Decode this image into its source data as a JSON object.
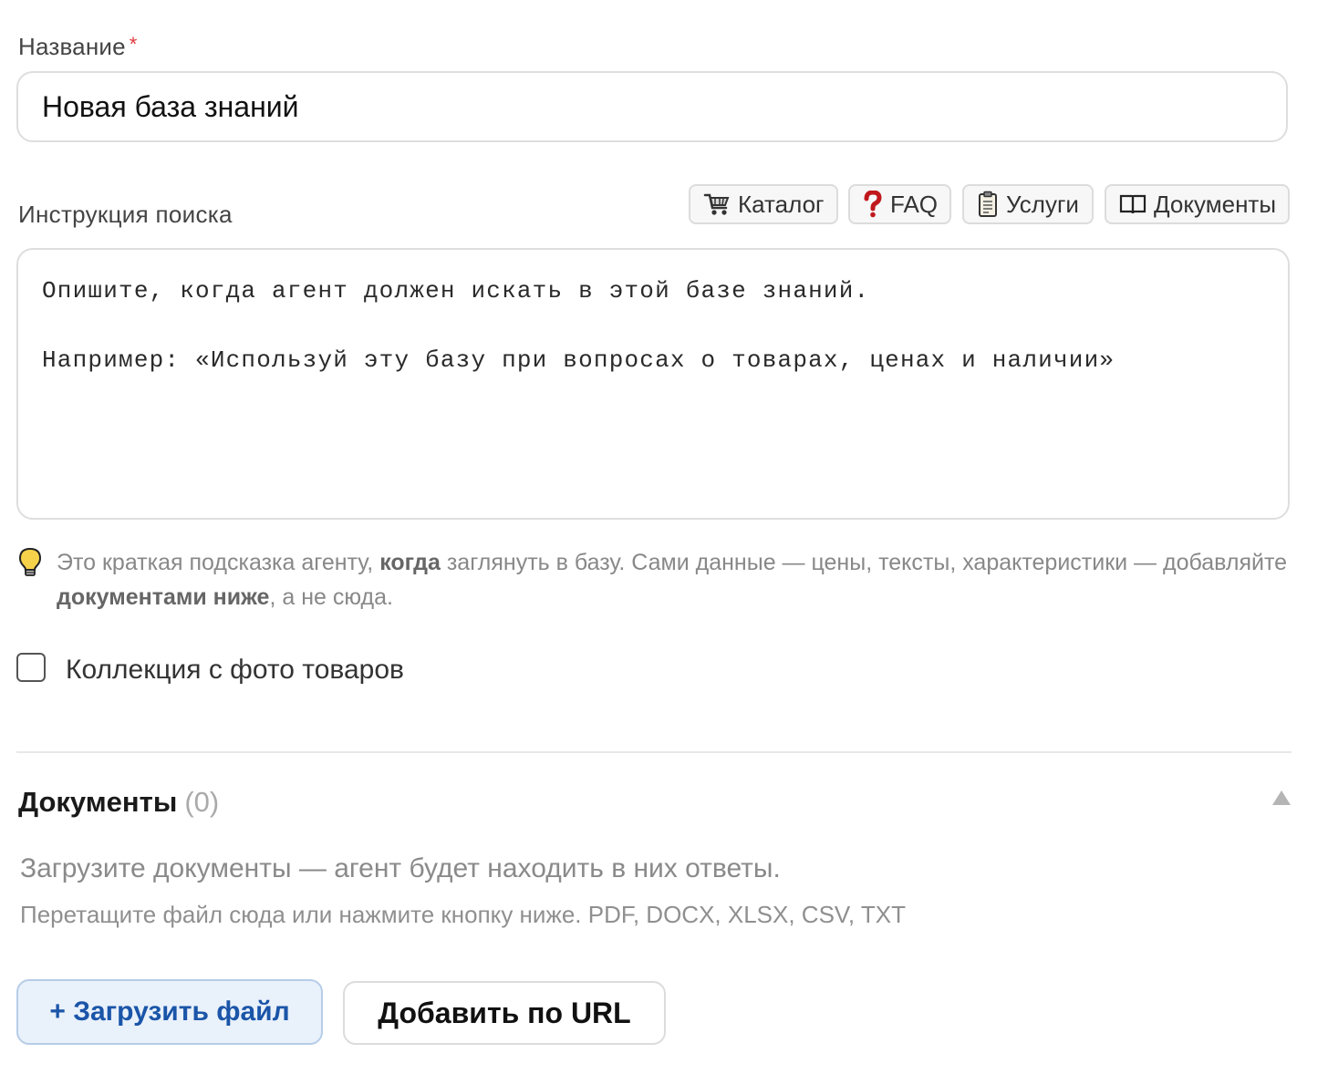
{
  "name_field": {
    "label": "Название",
    "required_mark": "*",
    "value": "Новая база знаний"
  },
  "search_instruction": {
    "label": "Инструкция поиска",
    "templates": [
      {
        "icon": "shopping-cart-icon",
        "label": "Каталог"
      },
      {
        "icon": "question-mark-icon",
        "label": "FAQ"
      },
      {
        "icon": "clipboard-icon",
        "label": "Услуги"
      },
      {
        "icon": "book-icon",
        "label": "Документы"
      }
    ],
    "placeholder": "Опишите, когда агент должен искать в этой базе знаний.\n\nНапример: «Используй эту базу при вопросах о товарах, ценах и наличии»"
  },
  "hint": {
    "icon": "lightbulb-icon",
    "part1": "Это краткая подсказка агенту, ",
    "bold1": "когда",
    "part2": " заглянуть в базу. Сами данные — цены, тексты, характеристики — добавляйте ",
    "bold2": "документами ниже",
    "part3": ", а не сюда."
  },
  "photo_collection": {
    "label": "Коллекция с фото товаров",
    "checked": false
  },
  "documents": {
    "title": "Документы",
    "count": "(0)",
    "description": "Загрузите документы — агент будет находить в них ответы.",
    "subtext": "Перетащите файл сюда или нажмите кнопку ниже. PDF, DOCX, XLSX, CSV, TXT",
    "upload_button": "+ Загрузить файл",
    "url_button": "Добавить по URL"
  },
  "colors": {
    "required": "#e0393e",
    "upload_button_bg": "#e9f1fb",
    "upload_button_text": "#1a55a8"
  }
}
